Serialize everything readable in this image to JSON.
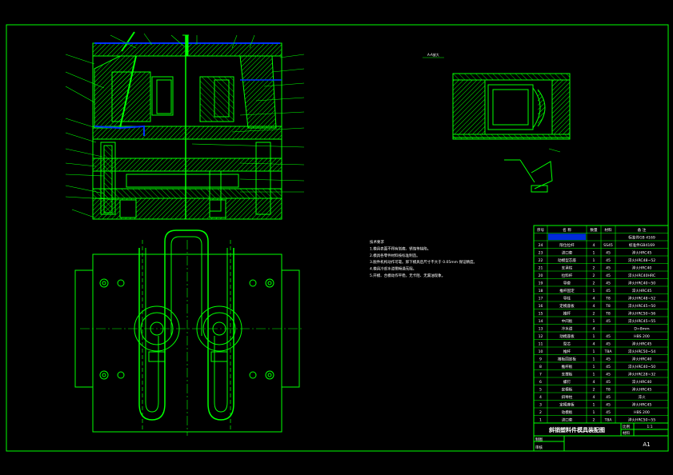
{
  "colors": {
    "background": "#000000",
    "line": "#00ff00",
    "hidden": "#00ffff",
    "label": "#ffffff",
    "highlight": "#0033ff",
    "part": "#00cc00"
  },
  "detail_label": "A-A放大",
  "tech_notes": [
    "技术要求",
    "1.模具表面不得有划痕、锈蚀等缺陷。",
    "2.模具各零件材料按标准制造。",
    "3.脱件机构动作可靠。卸下模具后尺寸不大于 0.05mm 保证精度。",
    "4.模具冷却水道需畅通无阻。",
    "5.开模、合模动作平稳，无卡阻、无漏油现象。"
  ],
  "bom": {
    "headers": [
      "序号",
      "名 称",
      "数量",
      "材料",
      "备 注"
    ],
    "rows": [
      [
        "",
        "",
        "",
        "",
        "标准件GB 4169"
      ],
      [
        "24",
        "限位拉杆",
        "4",
        "SS45",
        "标准件GB4169"
      ],
      [
        "23",
        "浇口套",
        "1",
        "45",
        "淬火HRC45"
      ],
      [
        "22",
        "动模型芯座",
        "1",
        "45",
        "淬火HRC48~52"
      ],
      [
        "21",
        "支承柱",
        "2",
        "45",
        "淬火HRC40"
      ],
      [
        "20",
        "拉料杆",
        "2",
        "45",
        "淬火HRC40HRC"
      ],
      [
        "19",
        "导套",
        "2",
        "45",
        "淬火HRC40~50"
      ],
      [
        "18",
        "推杆固定",
        "1",
        "45",
        "淬火HRC45"
      ],
      [
        "17",
        "导柱",
        "4",
        "T8",
        "淬火HRC48~52"
      ],
      [
        "16",
        "定模座板",
        "4",
        "T8",
        "淬火HRC45~50"
      ],
      [
        "15",
        "推杆",
        "2",
        "T8",
        "淬火HRC50~56"
      ],
      [
        "14",
        "中间板",
        "1",
        "45",
        "淬火HRC45~55"
      ],
      [
        "13",
        "冷水道",
        "4",
        "",
        "D=8mm"
      ],
      [
        "12",
        "动模座板",
        "1",
        "45",
        "HBS 200"
      ],
      [
        "11",
        "型芯",
        "4",
        "45",
        "淬火HRC45"
      ],
      [
        "10",
        "推杆",
        "1",
        "T8A",
        "淬火HRC50~54"
      ],
      [
        "9",
        "推板固定板",
        "1",
        "45",
        "淬火HRC40"
      ],
      [
        "8",
        "推杆板",
        "1",
        "45",
        "淬火HRC40~50"
      ],
      [
        "7",
        "支撑板",
        "1",
        "45",
        "淬火HRC28~32"
      ],
      [
        "6",
        "螺钉",
        "4",
        "45",
        "淬火HRC40"
      ],
      [
        "5",
        "定模板",
        "2",
        "T8",
        "淬火HRC45"
      ],
      [
        "4",
        "斜导柱",
        "4",
        "45",
        "淬火"
      ],
      [
        "3",
        "定模座板",
        "1",
        "45",
        "淬火HRC45"
      ],
      [
        "2",
        "动模板",
        "1",
        "45",
        "HBS 200"
      ],
      [
        "1",
        "浇口套",
        "2",
        "T8A",
        "淬火HRC50~55"
      ]
    ]
  },
  "title_block": {
    "title": "斜销塑料件模具装配图",
    "scale_label": "比例",
    "scale_value": "1:1",
    "draw_label": "制图",
    "check_label": "审核",
    "sheet_label": "材料",
    "size": "A1"
  }
}
